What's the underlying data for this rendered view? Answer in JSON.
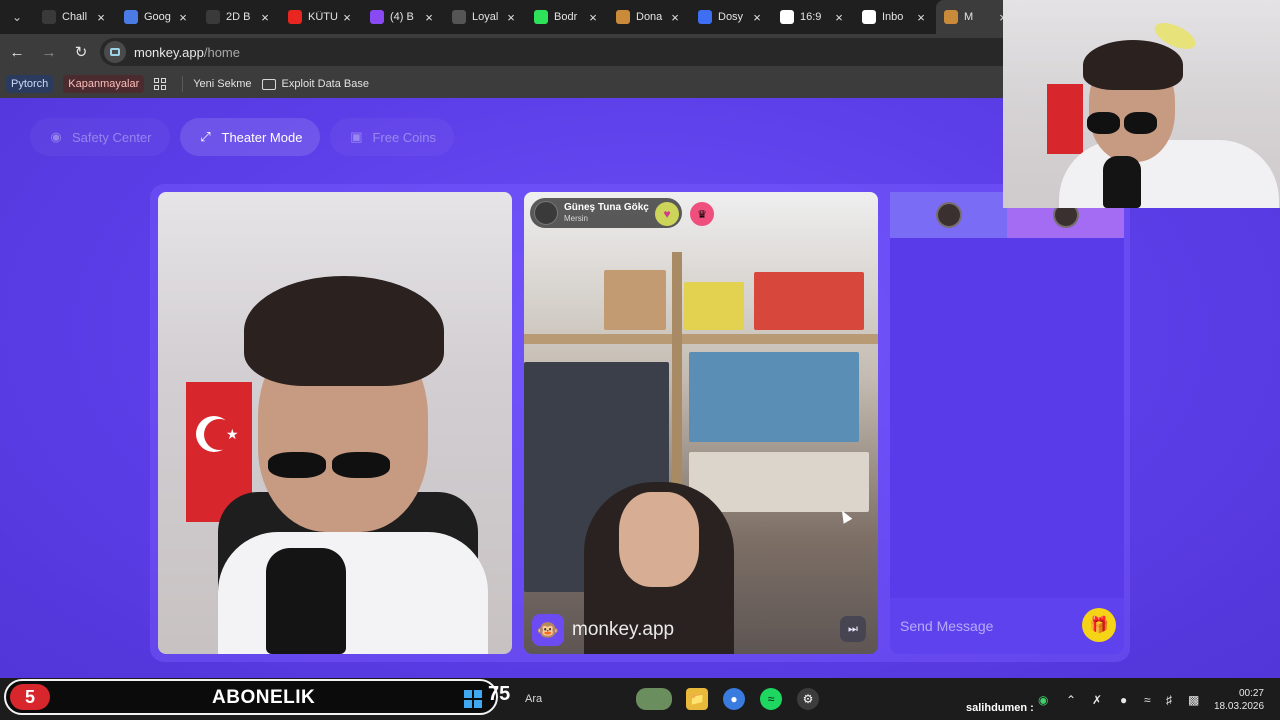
{
  "browser": {
    "tabs": [
      {
        "title": "Chall",
        "icon": "soccer-icon",
        "color": "#3a3a3a"
      },
      {
        "title": "Goog",
        "icon": "gemini-icon",
        "color": "#4b7be5"
      },
      {
        "title": "2D B",
        "icon": "soccer-icon",
        "color": "#3a3a3a"
      },
      {
        "title": "KÜTU",
        "icon": "youtube-icon",
        "color": "#e8261f"
      },
      {
        "title": "(4) B",
        "icon": "twitch-icon",
        "color": "#8a4af3"
      },
      {
        "title": "Loyal",
        "icon": "diamond-icon",
        "color": "#555555"
      },
      {
        "title": "Bodr",
        "icon": "kick-icon",
        "color": "#2ee25a"
      },
      {
        "title": "Dona",
        "icon": "emoji-icon",
        "color": "#c98b3a"
      },
      {
        "title": "Dosy",
        "icon": "heart-icon",
        "color": "#3e6ff2"
      },
      {
        "title": "16:9",
        "icon": "google-icon",
        "color": "#ffffff"
      },
      {
        "title": "Inbo",
        "icon": "gmail-icon",
        "color": "#ffffff"
      },
      {
        "title": "M",
        "icon": "monkey-icon",
        "color": "#c98b3a",
        "active": true
      }
    ],
    "url_host": "monkey.app",
    "url_path": "/home",
    "bookmarks": {
      "pytorch": "Pytorch",
      "kapanmayalar": "Kapanmayalar",
      "yeni_sekme": "Yeni Sekme",
      "exploit": "Exploit Data Base"
    }
  },
  "page": {
    "safety_center": "Safety Center",
    "theater_mode": "Theater Mode",
    "free_coins": "Free Coins",
    "peer": {
      "name": "Güneş Tuna Gökç",
      "location": "Mersin"
    },
    "watermark": "monkey.app",
    "chat_placeholder": "Send Message"
  },
  "taskbar": {
    "sub_count": "5",
    "sub_label": "ABONELIK",
    "sub_goal": "75",
    "search": "Ara",
    "tray_user": "salihdumen :",
    "time": "00:27",
    "date": "18.03.2026"
  }
}
